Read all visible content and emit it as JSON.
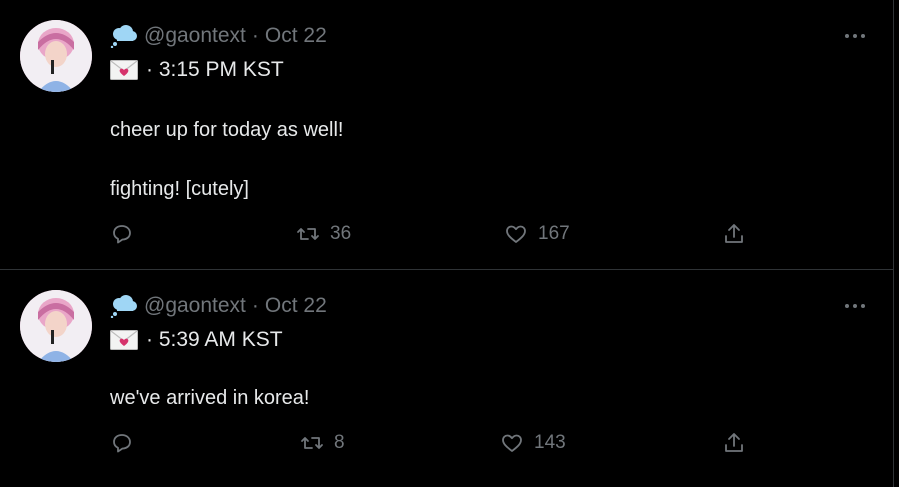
{
  "tweets": [
    {
      "handle": "@gaontext",
      "sep": "·",
      "date": "Oct 22",
      "time_line": "· 3:15 PM KST",
      "text_lines": [
        "cheer up for today as well!",
        "fighting! [cutely]"
      ],
      "retweets": "36",
      "likes": "167"
    },
    {
      "handle": "@gaontext",
      "sep": "·",
      "date": "Oct 22",
      "time_line": "· 5:39 AM KST",
      "text_lines": [
        "we've arrived in korea!"
      ],
      "retweets": "8",
      "likes": "143"
    }
  ],
  "icons": {
    "cloud": "speech-bubble-cloud",
    "envelope": "love-letter-envelope",
    "reply": "reply-bubble",
    "retweet": "retweet-arrows",
    "like": "heart-outline",
    "share": "share-upload",
    "more": "more-dots"
  },
  "colors": {
    "background": "#000000",
    "text_primary": "#e7e9ea",
    "text_secondary": "#71767b",
    "divider": "#2f3336",
    "heart_red": "#d6336c",
    "cloud_blue": "#9fd6f5"
  }
}
